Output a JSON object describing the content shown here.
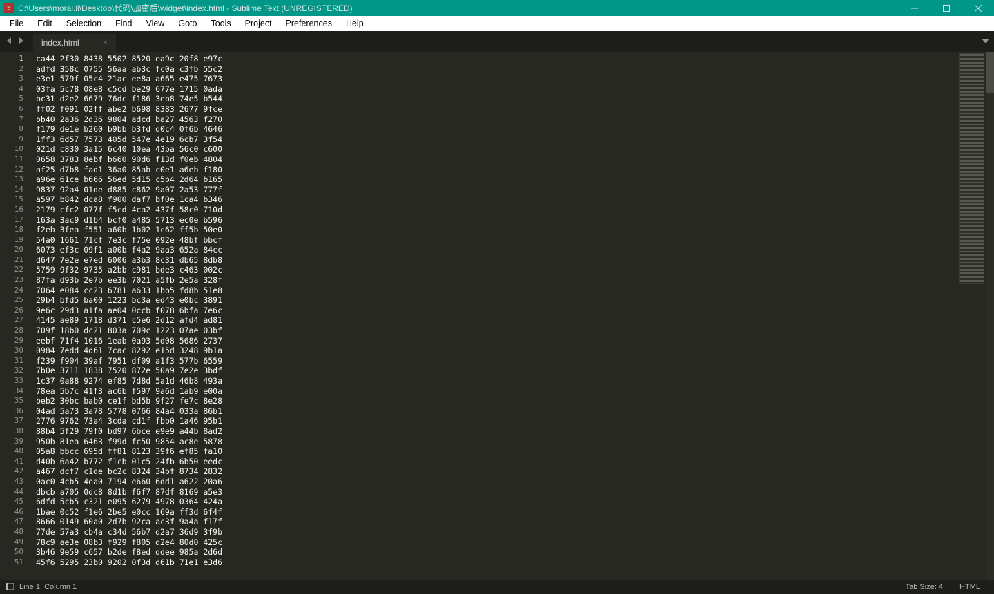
{
  "window": {
    "title": "C:\\Users\\moral.li\\Desktop\\代码\\加密后\\widget\\index.html - Sublime Text (UNREGISTERED)"
  },
  "menu": {
    "items": [
      "File",
      "Edit",
      "Selection",
      "Find",
      "View",
      "Goto",
      "Tools",
      "Project",
      "Preferences",
      "Help"
    ]
  },
  "tabs": {
    "active": {
      "label": "index.html"
    }
  },
  "editor": {
    "lines": [
      "ca44 2f30 8438 5502 8520 ea9c 20f8 e97c",
      "adfd 358c 0755 56aa ab3c fc0a c3fb 55c2",
      "e3e1 579f 05c4 21ac ee8a a665 e475 7673",
      "03fa 5c78 08e8 c5cd be29 677e 1715 0ada",
      "bc31 d2e2 6679 76dc f186 3eb8 74e5 b544",
      "ff02 f091 02ff abe2 b698 8383 2677 9fce",
      "bb40 2a36 2d36 9804 adcd ba27 4563 f270",
      "f179 de1e b260 b9bb b3fd d0c4 0f6b 4646",
      "1ff3 6d57 7573 405d 547e 4e19 6cb7 3f54",
      "021d c830 3a15 6c40 10ea 43ba 56c0 c600",
      "0658 3783 8ebf b660 90d6 f13d f0eb 4804",
      "af25 d7b8 fad1 36a0 85ab c0e1 a6eb f180",
      "a96e 61ce b666 56ed 5d15 c5b4 2d64 b165",
      "9837 92a4 01de d885 c862 9a07 2a53 777f",
      "a597 b842 dca8 f900 daf7 bf0e 1ca4 b346",
      "2179 cfc2 077f f5cd 4ca2 437f 58c0 710d",
      "163a 3ac9 d1b4 bcf0 a485 5713 ec0e b596",
      "f2eb 3fea f551 a60b 1b02 1c62 ff5b 50e0",
      "54a0 1661 71cf 7e3c f75e 092e 48bf bbcf",
      "6073 ef3c 09f1 a00b f4a2 9aa3 652a 84cc",
      "d647 7e2e e7ed 6006 a3b3 8c31 db65 8db8",
      "5759 9f32 9735 a2bb c981 bde3 c463 002c",
      "87fa d93b 2e7b ee3b 7021 a5fb 2e5a 328f",
      "7064 e084 cc23 6781 a633 1bb5 fd8b 51e8",
      "29b4 bfd5 ba00 1223 bc3a ed43 e0bc 3891",
      "9e6c 29d3 a1fa ae04 0ccb f078 6bfa 7e6c",
      "4145 ae89 1718 d371 c5e6 2d12 afd4 ad81",
      "709f 18b0 dc21 803a 709c 1223 07ae 03bf",
      "eebf 71f4 1016 1eab 0a93 5d08 5686 2737",
      "0984 7edd 4d61 7cac 8292 e15d 3248 9b1a",
      "f239 f904 39af 7951 df09 a1f3 577b 6559",
      "7b0e 3711 1838 7520 872e 50a9 7e2e 3bdf",
      "1c37 0a88 9274 ef85 7d8d 5a1d 46b8 493a",
      "78ea 5b7c 41f3 ac6b f597 9a6d 1ab9 e00a",
      "beb2 30bc bab0 ce1f bd5b 9f27 fe7c 8e28",
      "04ad 5a73 3a78 5778 0766 84a4 033a 86b1",
      "2776 9762 73a4 3cda cd1f fbb0 1a46 95b1",
      "88b4 5f29 79f0 bd97 6bce e9e9 a44b 8ad2",
      "950b 81ea 6463 f99d fc50 9854 ac8e 5878",
      "05a8 bbcc 695d ff81 8123 39f6 ef85 fa10",
      "d40b 6a42 b772 f1cb 01c5 24fb 6b50 eedc",
      "a467 dcf7 c1de bc2c 8324 34bf 8734 2832",
      "0ac0 4cb5 4ea0 7194 e660 6dd1 a622 20a6",
      "dbcb a705 0dc8 8d1b f6f7 87df 8169 a5e3",
      "6dfd 5cb5 c321 e095 6279 4978 0364 424a",
      "1bae 0c52 f1e6 2be5 e0cc 169a ff3d 6f4f",
      "8666 0149 60a0 2d7b 92ca ac3f 9a4a f17f",
      "77de 57a3 cb4a c34d 56b7 d2a7 36d9 3f9b",
      "78c9 ae3e 08b3 f929 f805 d2e4 80d0 425c",
      "3b46 9e59 c657 b2de f8ed ddee 985a 2d6d",
      "45f6 5295 23b0 9202 0f3d d61b 71e1 e3d6"
    ]
  },
  "status": {
    "cursor": "Line 1, Column 1",
    "tabsize": "Tab Size: 4",
    "syntax": "HTML"
  }
}
